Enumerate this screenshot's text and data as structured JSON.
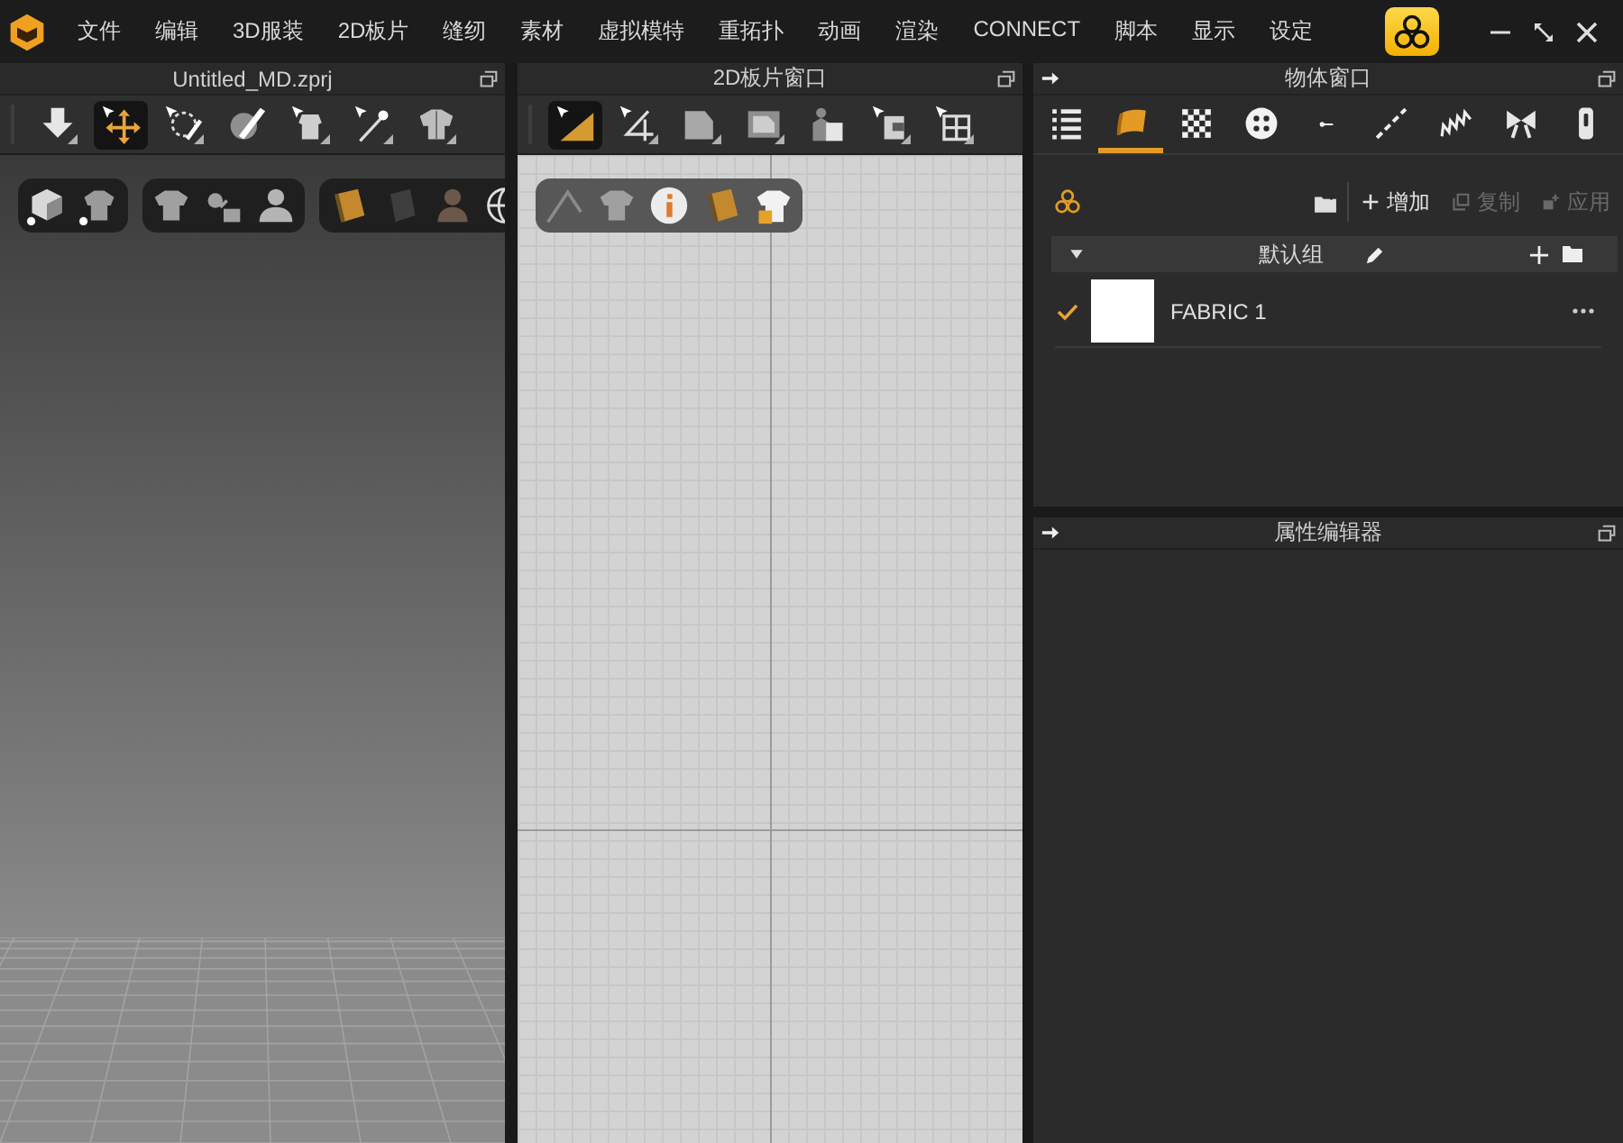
{
  "menu_bar": {
    "items": [
      "文件",
      "编辑",
      "3D服装",
      "2D板片",
      "缝纫",
      "素材",
      "虚拟模特",
      "重拓扑",
      "动画",
      "渲染",
      "CONNECT",
      "脚本",
      "显示",
      "设定"
    ]
  },
  "viewport_3d": {
    "title": "Untitled_MD.zprj",
    "tools": [
      {
        "kind": "drop",
        "selected": false
      },
      {
        "kind": "move",
        "selected": true
      },
      {
        "kind": "lasso",
        "selected": false
      },
      {
        "kind": "brush",
        "selected": false
      },
      {
        "kind": "garment",
        "selected": false
      },
      {
        "kind": "pin",
        "selected": false
      },
      {
        "kind": "tshirt",
        "selected": false
      }
    ],
    "view_groups": [
      {
        "buttons": [
          {
            "kind": "cube"
          },
          {
            "kind": "outfit"
          }
        ]
      },
      {
        "buttons": [
          {
            "kind": "shirt"
          },
          {
            "kind": "nodes"
          },
          {
            "kind": "avatar"
          }
        ]
      },
      {
        "buttons": [
          {
            "kind": "texture"
          },
          {
            "kind": "shade"
          },
          {
            "kind": "figure"
          },
          {
            "kind": "globe"
          }
        ]
      }
    ]
  },
  "pattern_2d": {
    "title": "2D板片窗口",
    "tools": [
      {
        "kind": "triangle",
        "selected": true
      },
      {
        "kind": "polyline",
        "selected": false
      },
      {
        "kind": "rectangle",
        "selected": false
      },
      {
        "kind": "frame",
        "selected": false
      },
      {
        "kind": "fitting",
        "selected": false
      },
      {
        "kind": "tuck",
        "selected": false
      },
      {
        "kind": "grid",
        "selected": false
      }
    ],
    "view_buttons": [
      {
        "kind": "needle"
      },
      {
        "kind": "shirt"
      },
      {
        "kind": "info"
      },
      {
        "kind": "texture"
      },
      {
        "kind": "locked"
      }
    ]
  },
  "object_browser": {
    "title": "物体窗口",
    "tabs": [
      {
        "kind": "list",
        "selected": false
      },
      {
        "kind": "fabric",
        "selected": true
      },
      {
        "kind": "checker",
        "selected": false
      },
      {
        "kind": "button",
        "selected": false
      },
      {
        "kind": "buttonhole",
        "selected": false
      },
      {
        "kind": "topstitch",
        "selected": false
      },
      {
        "kind": "spring",
        "selected": false
      },
      {
        "kind": "bow",
        "selected": false
      },
      {
        "kind": "zipper",
        "selected": false
      }
    ],
    "actions": [
      {
        "kind": "add",
        "label": "增加",
        "disabled": false
      },
      {
        "kind": "copy",
        "label": "复制",
        "disabled": true
      },
      {
        "kind": "apply",
        "label": "应用",
        "disabled": true
      }
    ],
    "group": {
      "name": "默认组",
      "expanded": true
    },
    "items": [
      {
        "name": "FABRIC 1",
        "checked": true,
        "color": "#ffffff"
      }
    ]
  },
  "property_editor": {
    "title": "属性编辑器"
  }
}
